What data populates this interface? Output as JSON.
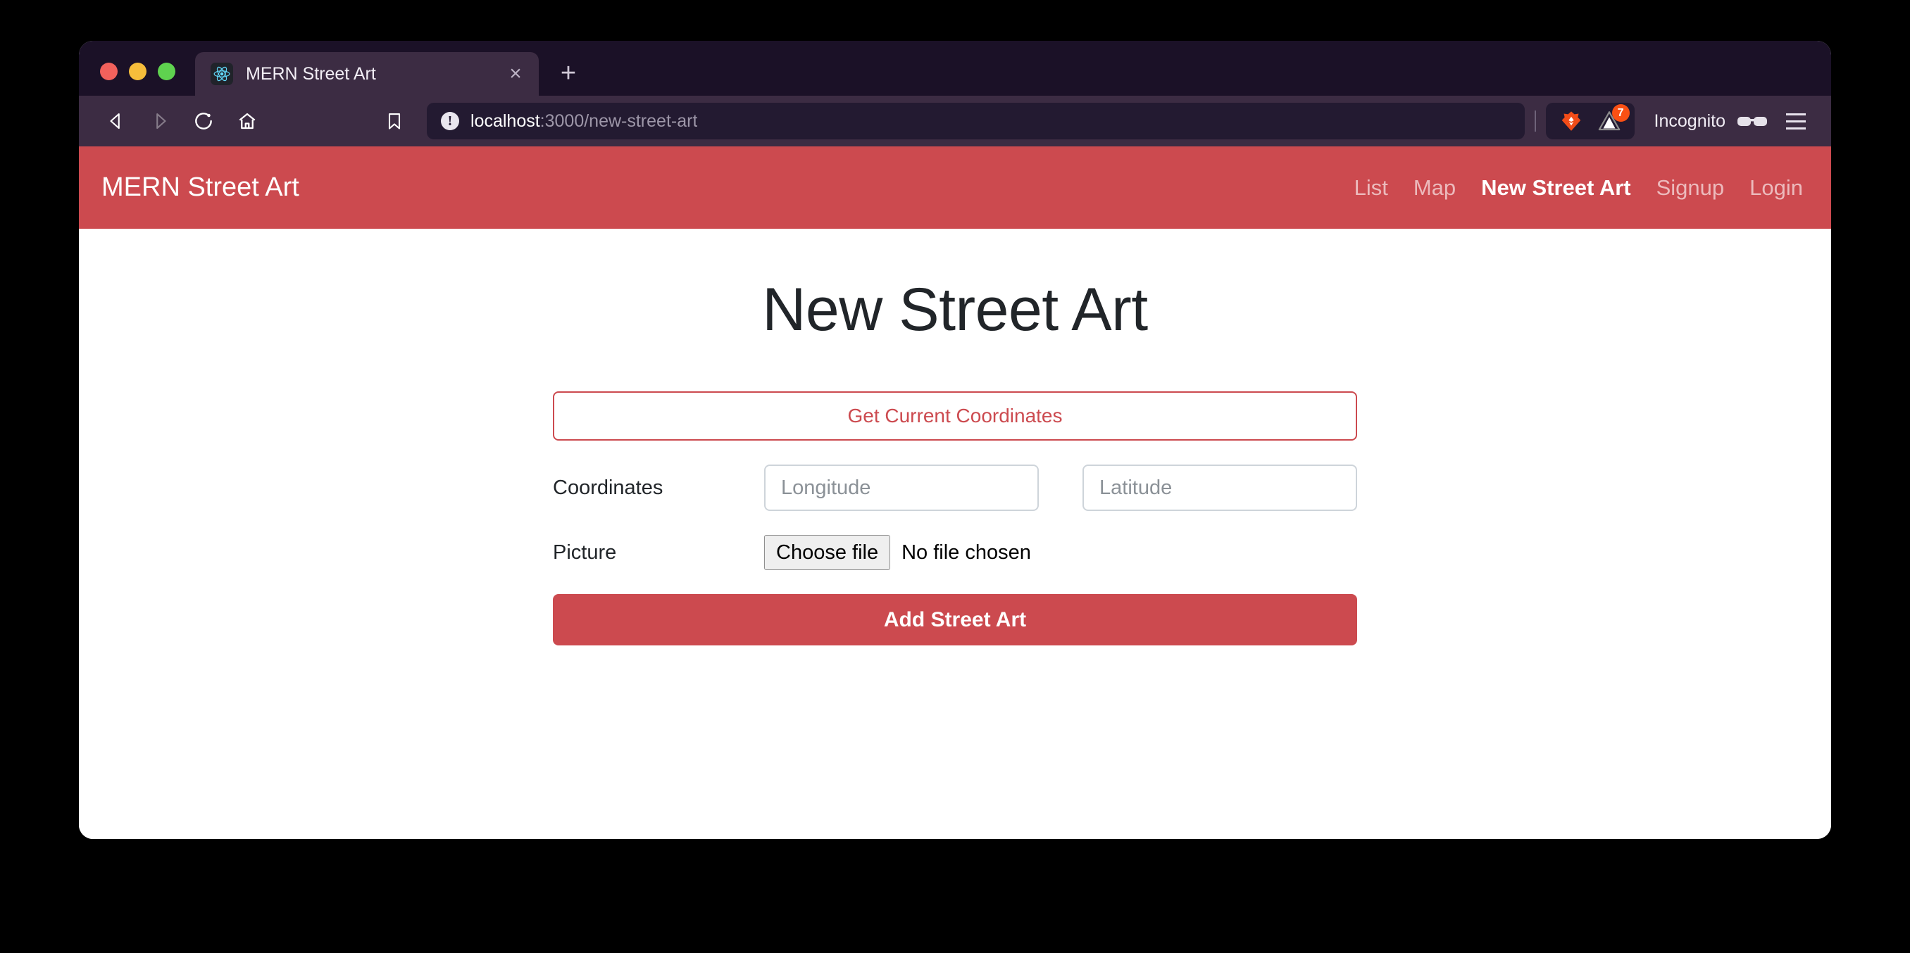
{
  "browser": {
    "name": "Brave",
    "tab": {
      "title": "MERN Street Art",
      "favicon": "react-icon",
      "close_label": "×"
    },
    "new_tab_label": "+",
    "toolbar": {
      "back_label": "◁",
      "forward_label": "▷",
      "reload_label": "↻",
      "home_label": "⌂",
      "bookmark_label": "☆",
      "url_host": "localhost",
      "url_path": ":3000/new-street-art",
      "url_full": "localhost:3000/new-street-art",
      "info_icon_label": "!",
      "shields_badge_count": "7",
      "profile_label": "Incognito",
      "menu_label": "☰"
    }
  },
  "site": {
    "brand": "MERN Street Art",
    "nav_links": [
      {
        "label": "List",
        "active": false
      },
      {
        "label": "Map",
        "active": false
      },
      {
        "label": "New Street Art",
        "active": true
      },
      {
        "label": "Signup",
        "active": false
      },
      {
        "label": "Login",
        "active": false
      }
    ],
    "page_title": "New Street Art",
    "form": {
      "get_coordinates_label": "Get Current Coordinates",
      "coordinates_label": "Coordinates",
      "longitude_placeholder": "Longitude",
      "longitude_value": "",
      "latitude_placeholder": "Latitude",
      "latitude_value": "",
      "picture_label": "Picture",
      "choose_file_label": "Choose file",
      "no_file_chosen_label": "No file chosen",
      "submit_label": "Add Street Art"
    }
  },
  "colors": {
    "brand_red": "#cc4a4f",
    "tab_bar": "#1b1127",
    "toolbar": "#3c2c43",
    "url_bar": "#231a31",
    "badge_orange": "#fa5014",
    "react_cyan": "#61dafb"
  }
}
